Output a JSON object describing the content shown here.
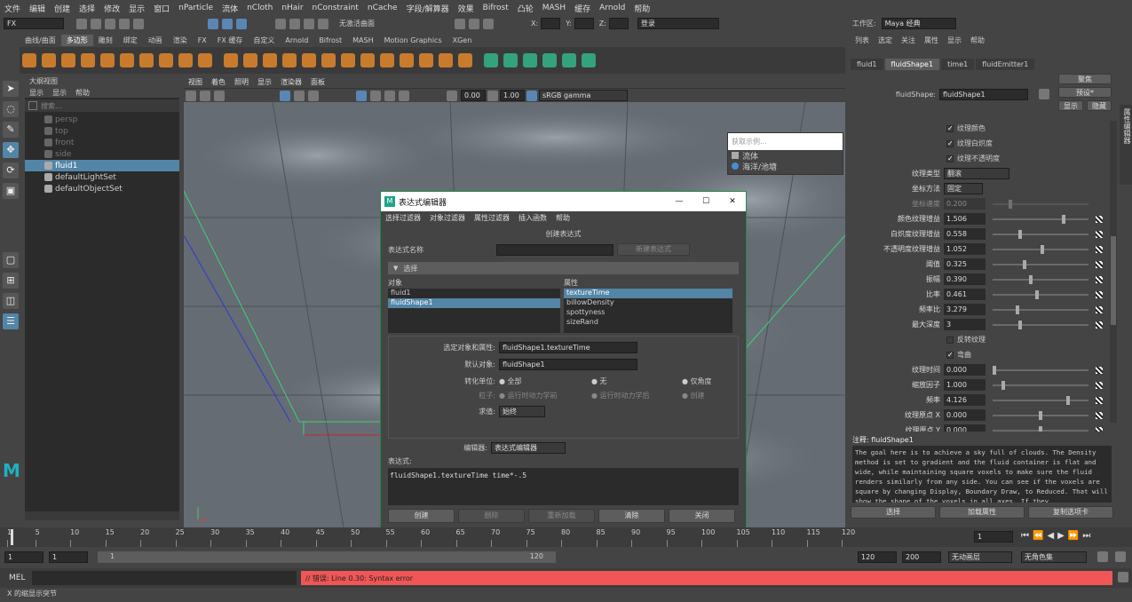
{
  "menubar": [
    "文件",
    "编辑",
    "创建",
    "选择",
    "修改",
    "显示",
    "窗口",
    "nParticle",
    "流体",
    "nCloth",
    "nHair",
    "nConstraint",
    "nCache",
    "字段/解算器",
    "效果",
    "Bifrost",
    "凸轮",
    "MASH",
    "缓存",
    "Arnold",
    "帮助"
  ],
  "workspace": {
    "label": "工作区:",
    "value": "Maya 经典"
  },
  "status": {
    "mode": "FX",
    "no_live": "无激活曲面",
    "x": "X:",
    "y": "Y:",
    "z": "Z:",
    "login": "登录"
  },
  "shelf_tabs": [
    "曲线/曲面",
    "多边形",
    "雕刻",
    "绑定",
    "动画",
    "渲染",
    "FX",
    "FX 缓存",
    "自定义",
    "Arnold",
    "Bifrost",
    "MASH",
    "Motion Graphics",
    "XGen"
  ],
  "shelf_active": "多边形",
  "outliner": {
    "title": "大纲视图",
    "menu": [
      "显示",
      "显示",
      "帮助"
    ],
    "search": "搜索...",
    "items": [
      {
        "label": "persp",
        "dim": true
      },
      {
        "label": "top",
        "dim": true
      },
      {
        "label": "front",
        "dim": true
      },
      {
        "label": "side",
        "dim": true
      },
      {
        "label": "fluid1",
        "sel": true
      },
      {
        "label": "defaultLightSet"
      },
      {
        "label": "defaultObjectSet"
      }
    ]
  },
  "viewport": {
    "menu": [
      "视图",
      "着色",
      "照明",
      "显示",
      "渲染器",
      "面板"
    ],
    "val1": "0.00",
    "val2": "1.00",
    "colorspace": "sRGB gamma"
  },
  "popup": {
    "search": "获取示例...",
    "items": [
      "流体",
      "海洋/池塘"
    ]
  },
  "attr": {
    "menu": [
      "列表",
      "选定",
      "关注",
      "属性",
      "显示",
      "帮助"
    ],
    "tabs": [
      "fluid1",
      "fluidShape1",
      "time1",
      "fluidEmitter1"
    ],
    "active_tab": "fluidShape1",
    "shape_label": "fluidShape:",
    "shape_value": "fluidShape1",
    "btn_focus": "聚焦",
    "btn_preset": "预设*",
    "btn_show": "显示",
    "btn_hide": "隐藏",
    "side_tab": "属性编辑器",
    "checks": [
      {
        "label": "纹理颜色",
        "on": true
      },
      {
        "label": "纹理白炽度",
        "on": true
      },
      {
        "label": "纹理不透明度",
        "on": true
      }
    ],
    "tex_type_label": "纹理类型",
    "tex_type": "翻滚",
    "coord_label": "坐标方法",
    "coord": "固定",
    "coord_speed_label": "坐标速度",
    "coord_speed": "0.200",
    "rows": [
      {
        "label": "颜色纹理增益",
        "value": "1.506",
        "pos": 0.75
      },
      {
        "label": "白炽度纹理增益",
        "value": "0.558",
        "pos": 0.28
      },
      {
        "label": "不透明度纹理增益",
        "value": "1.052",
        "pos": 0.52
      },
      {
        "label": "阈值",
        "value": "0.325",
        "pos": 0.33
      },
      {
        "label": "振幅",
        "value": "0.390",
        "pos": 0.39
      },
      {
        "label": "比率",
        "value": "0.461",
        "pos": 0.46
      },
      {
        "label": "频率比",
        "value": "3.279",
        "pos": 0.25
      },
      {
        "label": "最大深度",
        "value": "3",
        "pos": 0.28
      }
    ],
    "inflect_label": "反转纹理",
    "warp_label": "弯曲",
    "rows2": [
      {
        "label": "纹理时间",
        "value": "0.000",
        "pos": 0.0
      },
      {
        "label": "缩放因子",
        "value": "1.000",
        "pos": 0.1
      },
      {
        "label": "频率",
        "value": "4.126",
        "pos": 0.8
      },
      {
        "label": "纹理原点 X",
        "value": "0.000",
        "pos": 0.5
      },
      {
        "label": "纹理原点 Y",
        "value": "0.000",
        "pos": 0.5
      }
    ],
    "notes_label": "注释: fluidShape1",
    "notes": "The goal here is to achieve a sky full of clouds. The Density method is set to gradient and the fluid container is flat and wide, while maintaining square voxels to make sure the fluid renders similarly from any side. You can see if the voxels are square by changing Display, Boundary Draw, to Reduced. That will show the shape of the voxels in all axes. If they",
    "bottom": [
      "选择",
      "加载属性",
      "复制选项卡"
    ]
  },
  "dialog": {
    "title": "表达式编辑器",
    "menu": [
      "选择过滤器",
      "对象过滤器",
      "属性过滤器",
      "插入函数",
      "帮助"
    ],
    "create_title": "创建表达式",
    "name_label": "表达式名称",
    "new_btn": "新建表达式",
    "select_label": "选择",
    "obj_header": "对象",
    "attr_header": "属性",
    "objects": [
      "fluid1",
      "fluidShape1"
    ],
    "attrs": [
      "textureTime",
      "billowDensity",
      "spottyness",
      "sizeRand"
    ],
    "sel_label": "选定对象和属性:",
    "sel_value": "fluidShape1.textureTime",
    "def_label": "默认对象:",
    "def_value": "fluidShape1",
    "unit_label": "转化单位:",
    "unit_all": "全部",
    "unit_none": "无",
    "unit_angle": "仅角度",
    "particle_label": "粒子:",
    "before": "运行时动力学前",
    "after": "运行时动力学后",
    "create": "创建",
    "eval_label": "求值:",
    "eval_value": "始终",
    "editor_label": "编辑器:",
    "editor_value": "表达式编辑器",
    "expr_label": "表达式:",
    "expr": "fluidShape1.textureTime time*-.5",
    "buttons": [
      "创建",
      "删除",
      "重新加载",
      "清除",
      "关闭"
    ]
  },
  "timeline": {
    "ticks": [
      "1",
      "5",
      "10",
      "15",
      "20",
      "25",
      "30",
      "35",
      "40",
      "45",
      "50",
      "55",
      "60",
      "65",
      "70",
      "75",
      "80",
      "85",
      "90",
      "95",
      "100",
      "105",
      "110",
      "115",
      "120"
    ],
    "current": "1"
  },
  "range": {
    "start": "1",
    "start2": "1",
    "bar_start": "1",
    "bar_end": "120",
    "end": "120",
    "end2": "200",
    "anim_layer": "无动画层",
    "char_set": "无角色集"
  },
  "cmd": {
    "label": "MEL",
    "error": "// 错误: Line 0.30: Syntax error"
  },
  "help": "X 的缩显示突节"
}
